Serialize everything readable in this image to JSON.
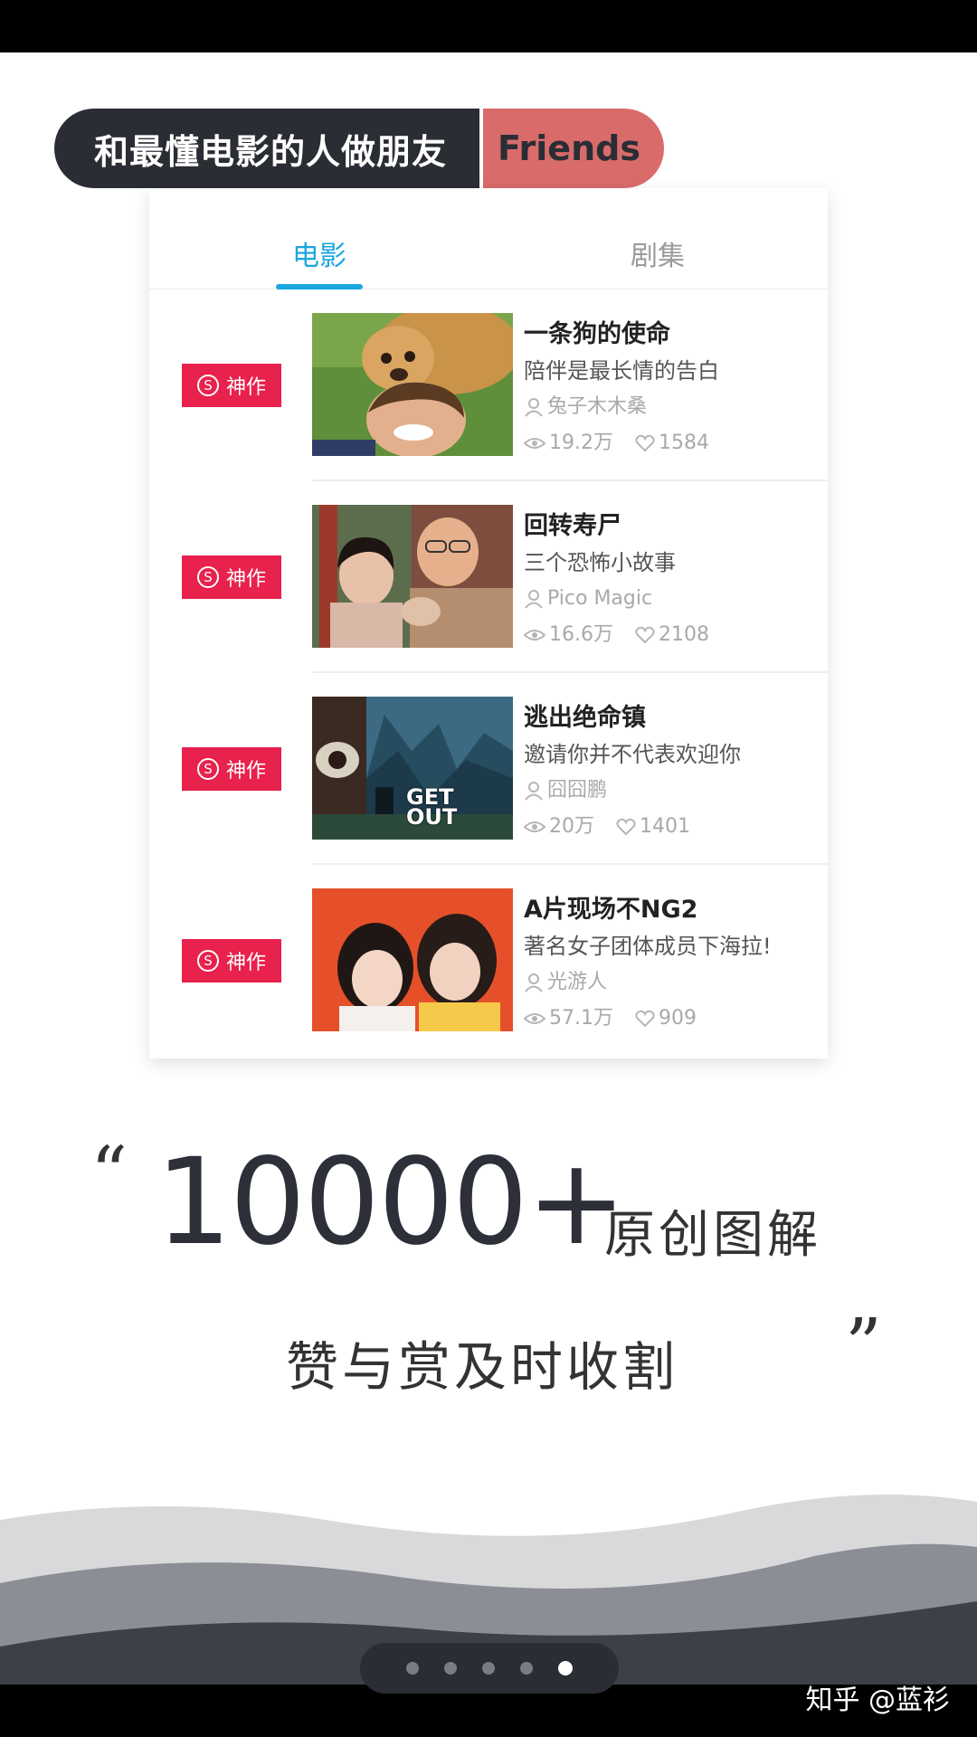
{
  "banner": {
    "left_text": "和最懂电影的人做朋友",
    "right_text": "Friends"
  },
  "tabs": [
    {
      "label": "电影",
      "active": true
    },
    {
      "label": "剧集",
      "active": false
    }
  ],
  "items": [
    {
      "badge": "神作",
      "title": "一条狗的使命",
      "subtitle": "陪伴是最长情的告白",
      "author": "兔子木木桑",
      "views": "19.2万",
      "likes": "1584",
      "thumb_icon": "dog-and-boy-poster"
    },
    {
      "badge": "神作",
      "title": "回转寿尸",
      "subtitle": "三个恐怖小故事",
      "author": "Pico Magic",
      "views": "16.6万",
      "likes": "2108",
      "thumb_icon": "two-people-poster"
    },
    {
      "badge": "神作",
      "title": "逃出绝命镇",
      "subtitle": "邀请你并不代表欢迎你",
      "author": "囧囧鹏",
      "views": "20万",
      "likes": "1401",
      "thumb_icon": "get-out-poster",
      "thumb_text": "GET OUT"
    },
    {
      "badge": "神作",
      "title": "A片现场不NG2",
      "subtitle": "著名女子团体成员下海拉!",
      "author": "光游人",
      "views": "57.1万",
      "likes": "909",
      "thumb_icon": "two-girls-poster"
    }
  ],
  "promo": {
    "open_quote": "“",
    "number": "10000+",
    "suffix": "原创图解",
    "line2": "赞与赏及时收割",
    "close_quote": "”"
  },
  "pager": {
    "count": 5,
    "active_index": 4
  },
  "watermark": "知乎 @蓝衫",
  "colors": {
    "accent_blue": "#1aa6de",
    "badge_red": "#e8214d",
    "banner_dark": "#2b2d35",
    "banner_pink": "#d96b6b"
  }
}
